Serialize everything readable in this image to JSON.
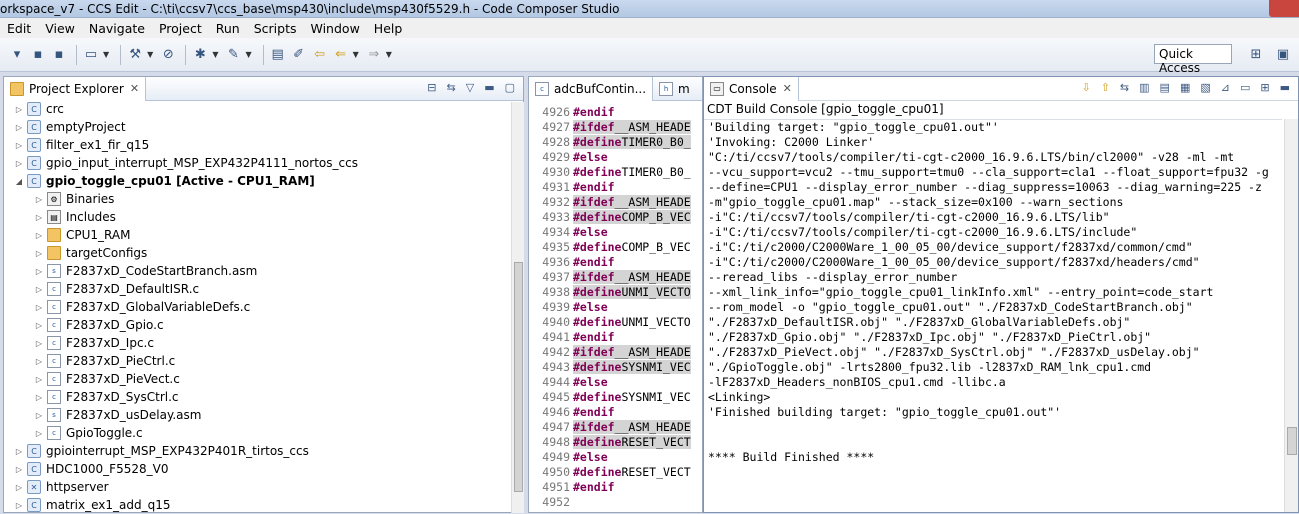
{
  "window": {
    "title": "orkspace_v7 - CCS Edit - C:\\ti\\ccsv7\\ccs_base\\msp430\\include\\msp430f5529.h - Code Composer Studio"
  },
  "menu": [
    "Edit",
    "View",
    "Navigate",
    "Project",
    "Run",
    "Scripts",
    "Window",
    "Help"
  ],
  "quick_access": "Quick Access",
  "project_explorer": {
    "tab_label": "Project Explorer",
    "items": [
      {
        "label": "crc",
        "icon": "project-icon",
        "level": 0,
        "twisty": "collapsed"
      },
      {
        "label": "emptyProject",
        "icon": "project-icon",
        "level": 0,
        "twisty": "collapsed"
      },
      {
        "label": "filter_ex1_fir_q15",
        "icon": "project-icon",
        "level": 0,
        "twisty": "collapsed"
      },
      {
        "label": "gpio_input_interrupt_MSP_EXP432P4111_nortos_ccs",
        "icon": "project-icon",
        "level": 0,
        "twisty": "collapsed"
      },
      {
        "label": "gpio_toggle_cpu01  [Active - CPU1_RAM]",
        "icon": "project-icon",
        "level": 0,
        "twisty": "expanded",
        "bold": true
      },
      {
        "label": "Binaries",
        "icon": "binaries-icon",
        "level": 1,
        "twisty": "collapsed"
      },
      {
        "label": "Includes",
        "icon": "includes-icon",
        "level": 1,
        "twisty": "collapsed"
      },
      {
        "label": "CPU1_RAM",
        "icon": "folder-icon",
        "level": 1,
        "twisty": "collapsed"
      },
      {
        "label": "targetConfigs",
        "icon": "folder-icon",
        "level": 1,
        "twisty": "collapsed"
      },
      {
        "label": "F2837xD_CodeStartBranch.asm",
        "icon": "asm-file-icon",
        "level": 1,
        "twisty": "collapsed"
      },
      {
        "label": "F2837xD_DefaultISR.c",
        "icon": "c-file-icon",
        "level": 1,
        "twisty": "collapsed"
      },
      {
        "label": "F2837xD_GlobalVariableDefs.c",
        "icon": "c-file-icon",
        "level": 1,
        "twisty": "collapsed"
      },
      {
        "label": "F2837xD_Gpio.c",
        "icon": "c-file-icon",
        "level": 1,
        "twisty": "collapsed"
      },
      {
        "label": "F2837xD_Ipc.c",
        "icon": "c-file-icon",
        "level": 1,
        "twisty": "collapsed"
      },
      {
        "label": "F2837xD_PieCtrl.c",
        "icon": "c-file-icon",
        "level": 1,
        "twisty": "collapsed"
      },
      {
        "label": "F2837xD_PieVect.c",
        "icon": "c-file-icon",
        "level": 1,
        "twisty": "collapsed"
      },
      {
        "label": "F2837xD_SysCtrl.c",
        "icon": "c-file-icon",
        "level": 1,
        "twisty": "collapsed"
      },
      {
        "label": "F2837xD_usDelay.asm",
        "icon": "asm-file-icon",
        "level": 1,
        "twisty": "collapsed"
      },
      {
        "label": "GpioToggle.c",
        "icon": "c-file-icon",
        "level": 1,
        "twisty": "collapsed"
      },
      {
        "label": "gpiointerrupt_MSP_EXP432P401R_tirtos_ccs",
        "icon": "project-icon",
        "level": 0,
        "twisty": "collapsed"
      },
      {
        "label": "HDC1000_F5528_V0",
        "icon": "project-icon",
        "level": 0,
        "twisty": "collapsed"
      },
      {
        "label": "httpserver",
        "icon": "project-error-icon",
        "level": 0,
        "twisty": "collapsed"
      },
      {
        "label": "matrix_ex1_add_q15",
        "icon": "project-icon",
        "level": 0,
        "twisty": "collapsed"
      }
    ]
  },
  "editor": {
    "tabs": [
      "adcBufContin...",
      "m"
    ],
    "lines": [
      {
        "n": "4926",
        "kw": "#endif",
        "rest": "",
        "hl": false
      },
      {
        "n": "4927",
        "kw": "#ifdef",
        "rest": " __ASM_HEADE",
        "hl": true
      },
      {
        "n": "4928",
        "kw": "#define",
        "rest": " TIMER0_B0_",
        "hl": true
      },
      {
        "n": "4929",
        "kw": "#else",
        "rest": "",
        "hl": false
      },
      {
        "n": "4930",
        "kw": "#define",
        "rest": " TIMER0_B0_",
        "hl": false
      },
      {
        "n": "4931",
        "kw": "#endif",
        "rest": "",
        "hl": false
      },
      {
        "n": "4932",
        "kw": "#ifdef",
        "rest": " __ASM_HEADE",
        "hl": true
      },
      {
        "n": "4933",
        "kw": "#define",
        "rest": " COMP_B_VEC",
        "hl": true
      },
      {
        "n": "4934",
        "kw": "#else",
        "rest": "",
        "hl": false
      },
      {
        "n": "4935",
        "kw": "#define",
        "rest": " COMP_B_VEC",
        "hl": false
      },
      {
        "n": "4936",
        "kw": "#endif",
        "rest": "",
        "hl": false
      },
      {
        "n": "4937",
        "kw": "#ifdef",
        "rest": " __ASM_HEADE",
        "hl": true
      },
      {
        "n": "4938",
        "kw": "#define",
        "rest": " UNMI_VECTO",
        "hl": true
      },
      {
        "n": "4939",
        "kw": "#else",
        "rest": "",
        "hl": false
      },
      {
        "n": "4940",
        "kw": "#define",
        "rest": " UNMI_VECTO",
        "hl": false
      },
      {
        "n": "4941",
        "kw": "#endif",
        "rest": "",
        "hl": false
      },
      {
        "n": "4942",
        "kw": "#ifdef",
        "rest": " __ASM_HEADE",
        "hl": true
      },
      {
        "n": "4943",
        "kw": "#define",
        "rest": " SYSNMI_VEC",
        "hl": true
      },
      {
        "n": "4944",
        "kw": "#else",
        "rest": "",
        "hl": false
      },
      {
        "n": "4945",
        "kw": "#define",
        "rest": " SYSNMI_VEC",
        "hl": false
      },
      {
        "n": "4946",
        "kw": "#endif",
        "rest": "",
        "hl": false
      },
      {
        "n": "4947",
        "kw": "#ifdef",
        "rest": " __ASM_HEADE",
        "hl": true
      },
      {
        "n": "4948",
        "kw": "#define",
        "rest": " RESET_VECT",
        "hl": true
      },
      {
        "n": "4949",
        "kw": "#else",
        "rest": "",
        "hl": false
      },
      {
        "n": "4950",
        "kw": "#define",
        "rest": " RESET_VECT",
        "hl": false
      },
      {
        "n": "4951",
        "kw": "#endif",
        "rest": "",
        "hl": false
      },
      {
        "n": "4952",
        "kw": "",
        "rest": "",
        "hl": false
      }
    ]
  },
  "console": {
    "tab_label": "Console",
    "title": "CDT Build Console [gpio_toggle_cpu01]",
    "lines": [
      "'Building target: \"gpio_toggle_cpu01.out\"'",
      "'Invoking: C2000 Linker'",
      "\"C:/ti/ccsv7/tools/compiler/ti-cgt-c2000_16.9.6.LTS/bin/cl2000\" -v28 -ml -mt",
      "--vcu_support=vcu2 --tmu_support=tmu0 --cla_support=cla1 --float_support=fpu32 -g",
      "--define=CPU1 --display_error_number --diag_suppress=10063 --diag_warning=225 -z",
      "-m\"gpio_toggle_cpu01.map\" --stack_size=0x100 --warn_sections",
      "-i\"C:/ti/ccsv7/tools/compiler/ti-cgt-c2000_16.9.6.LTS/lib\"",
      "-i\"C:/ti/ccsv7/tools/compiler/ti-cgt-c2000_16.9.6.LTS/include\"",
      "-i\"C:/ti/c2000/C2000Ware_1_00_05_00/device_support/f2837xd/common/cmd\"",
      "-i\"C:/ti/c2000/C2000Ware_1_00_05_00/device_support/f2837xd/headers/cmd\"",
      "--reread_libs --display_error_number",
      "--xml_link_info=\"gpio_toggle_cpu01_linkInfo.xml\" --entry_point=code_start",
      "--rom_model -o \"gpio_toggle_cpu01.out\" \"./F2837xD_CodeStartBranch.obj\"",
      "\"./F2837xD_DefaultISR.obj\" \"./F2837xD_GlobalVariableDefs.obj\"",
      "\"./F2837xD_Gpio.obj\" \"./F2837xD_Ipc.obj\" \"./F2837xD_PieCtrl.obj\"",
      "\"./F2837xD_PieVect.obj\" \"./F2837xD_SysCtrl.obj\" \"./F2837xD_usDelay.obj\"",
      "\"./GpioToggle.obj\"  -lrts2800_fpu32.lib -l2837xD_RAM_lnk_cpu1.cmd",
      "-lF2837xD_Headers_nonBIOS_cpu1.cmd -llibc.a",
      "<Linking>",
      "'Finished building target: \"gpio_toggle_cpu01.out\"'",
      "",
      "",
      "**** Build Finished ****"
    ]
  },
  "colors": {
    "keyword": "#7f0055",
    "highlight": "#d4d4d4",
    "accent": "#3d5a84"
  }
}
